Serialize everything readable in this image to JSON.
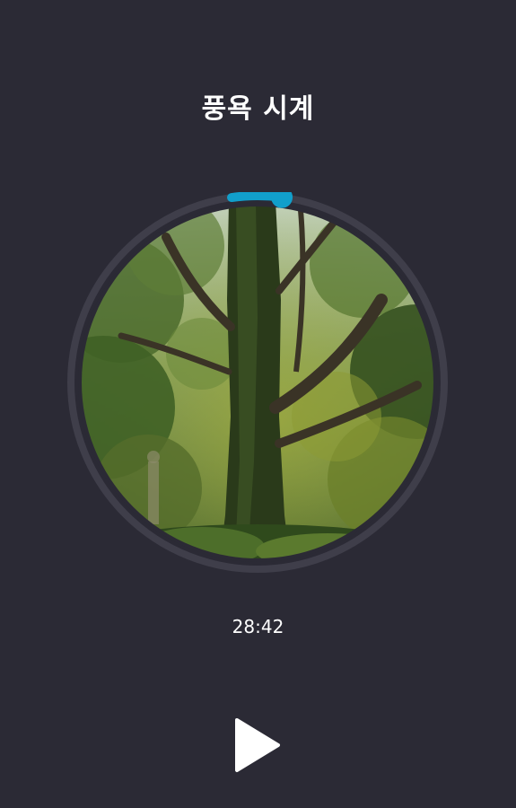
{
  "screen": {
    "title": "풍욕 시계",
    "time_remaining": "28:42",
    "progress_fraction": 0.043,
    "photo_subject": "forest-tree-photo"
  },
  "colors": {
    "background": "#2b2a35",
    "ring_track": "#3f3e4a",
    "progress_accent": "#119fcb",
    "text": "#ffffff"
  },
  "controls": {
    "play_icon": "play-icon"
  }
}
